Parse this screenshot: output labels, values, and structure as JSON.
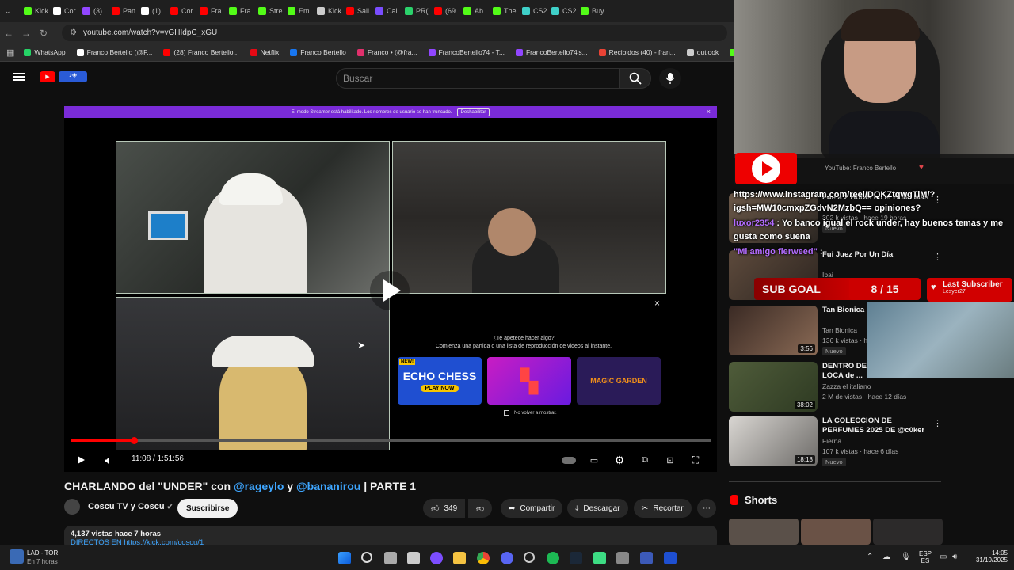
{
  "tabs": [
    {
      "label": "Kick",
      "color": "#53fc18"
    },
    {
      "label": "Cor",
      "color": "#ffffff"
    },
    {
      "label": "(3)",
      "color": "#9146ff"
    },
    {
      "label": "Pan",
      "color": "#ff0000"
    },
    {
      "label": "(1)",
      "color": "#ffffff"
    },
    {
      "label": "Cor",
      "color": "#ff0000"
    },
    {
      "label": "Fra",
      "color": "#ff0000"
    },
    {
      "label": "Fra",
      "color": "#53fc18"
    },
    {
      "label": "Stre",
      "color": "#53fc18"
    },
    {
      "label": "Em",
      "color": "#53fc18"
    },
    {
      "label": "Kick",
      "color": "#cccccc"
    },
    {
      "label": "Sali",
      "color": "#ff0000"
    },
    {
      "label": "Cal",
      "color": "#7a4dff"
    },
    {
      "label": "PR(",
      "color": "#2bd26b"
    },
    {
      "label": "(69",
      "color": "#ff0000"
    },
    {
      "label": "Ab",
      "color": "#53fc18"
    },
    {
      "label": "The",
      "color": "#53fc18"
    },
    {
      "label": "CS2",
      "color": "#3fd0c9"
    },
    {
      "label": "CS2",
      "color": "#3fd0c9"
    },
    {
      "label": "Buy",
      "color": "#53fc18"
    }
  ],
  "address": {
    "url": "youtube.com/watch?v=vGHIdpC_xGU"
  },
  "bookmarks": [
    {
      "label": "WhatsApp",
      "color": "#25d366"
    },
    {
      "label": "Franco Bertello (@F...",
      "color": "#ffffff"
    },
    {
      "label": "(28) Franco Bertello...",
      "color": "#ff0000"
    },
    {
      "label": "Netflix",
      "color": "#e50914"
    },
    {
      "label": "Franco Bertello",
      "color": "#1877f2"
    },
    {
      "label": "Franco • (@fra...",
      "color": "#e1306c"
    },
    {
      "label": "FrancoBertello74 - T...",
      "color": "#9146ff"
    },
    {
      "label": "FrancoBertello74's...",
      "color": "#9146ff"
    },
    {
      "label": "Recibidos (40) - fran...",
      "color": "#ea4335"
    },
    {
      "label": "outlook",
      "color": "#cccccc"
    },
    {
      "label": "Aler",
      "color": "#53fc18"
    }
  ],
  "youtube": {
    "search_placeholder": "Buscar"
  },
  "player": {
    "streamer_notice": "El modo Streamer está habilitado. Los nombres de usuario se han truncado.",
    "streamer_button": "Deshabilitar",
    "promo_title": "¿Te apetece hacer algo?",
    "promo_subtitle": "Comienza una partida o una lista de reproducción de videos al instante.",
    "games": [
      "ECHO CHESS",
      "",
      "MAGIC GARDEN"
    ],
    "game_badge": "NEW!",
    "play_now": "PLAY NOW",
    "dont_show": "No volver a mostrar.",
    "time": "11:08 / 1:51:56",
    "progress_fraction": 0.099
  },
  "video": {
    "title_pre": "CHARLANDO del \"UNDER\" con ",
    "mention1": "@rageylo",
    "title_mid": " y ",
    "mention2": "@bananirou",
    "title_post": " | PARTE 1",
    "channel": "Coscu TV y Coscu",
    "subscribe": "Suscribirse",
    "likes": "349",
    "share": "Compartir",
    "download": "Descargar",
    "clip": "Recortar",
    "views": "4,137 vistas  hace 7 horas",
    "desc_line": "DIRECTOS EN https://kick.com/coscu/1"
  },
  "recommendations": [
    {
      "title": "Fue a 2 Horas en el Hotel Más",
      "channel": "",
      "meta": "302 k vistas · hace 19 horas",
      "badge": "Nuevo",
      "duration": ""
    },
    {
      "title": "Fui Juez Por Un Día",
      "channel": "Ibai",
      "meta": "867 k vistas",
      "badge": "",
      "duration": ""
    },
    {
      "title": "Tan Bionica - Amor (Video",
      "channel": "Tan Bionica",
      "meta": "136 k vistas · hace 1 día",
      "badge": "Nuevo",
      "duration": "3:56"
    },
    {
      "title": "DENTRO DE LA VILLA MÁS LOCA de ...",
      "channel": "Zazza el italiano",
      "meta": "2 M de vistas · hace 12 días",
      "badge": "",
      "duration": "38:02"
    },
    {
      "title": "LA COLECCION DE PERFUMES 2025 DE @c0ker",
      "channel": "Fierna",
      "meta": "107 k vistas · hace 6 días",
      "badge": "Nuevo",
      "duration": "18:18"
    }
  ],
  "shorts_label": "Shorts",
  "overlay": {
    "yt_label": "YouTube: Franco Bertello",
    "chat": [
      {
        "user": "",
        "text": "https://www.instagram.com/reel/DQKZtqwgTiM/?igsh=MW10cmxpZGdvN2MzbQ== opiniones?"
      },
      {
        "user": "luxor2354",
        "text": " : Yo banco igual el rock under, hay buenos temas y me gusta como suena"
      },
      {
        "user": "\"Mi amigo fierweed\"",
        "text": " :"
      }
    ],
    "sub_goal_label": "SUB GOAL",
    "sub_goal_current": "8",
    "sub_goal_target": "15",
    "sub_goal_text": "8 / 15",
    "last_sub_label": "Last Subscriber",
    "last_sub_user": "Lesyer27"
  },
  "taskbar": {
    "weather_title": "LAD - TOR",
    "weather_sub": "En 7 horas",
    "lang_top": "ESP",
    "lang_bottom": "ES",
    "time": "14:05",
    "date": "31/10/2025"
  },
  "colors": {
    "accent": "#ff0000",
    "link": "#3ea6ff",
    "streamer_bar": "#7a2bd8",
    "sub_goal": "#d10000"
  }
}
